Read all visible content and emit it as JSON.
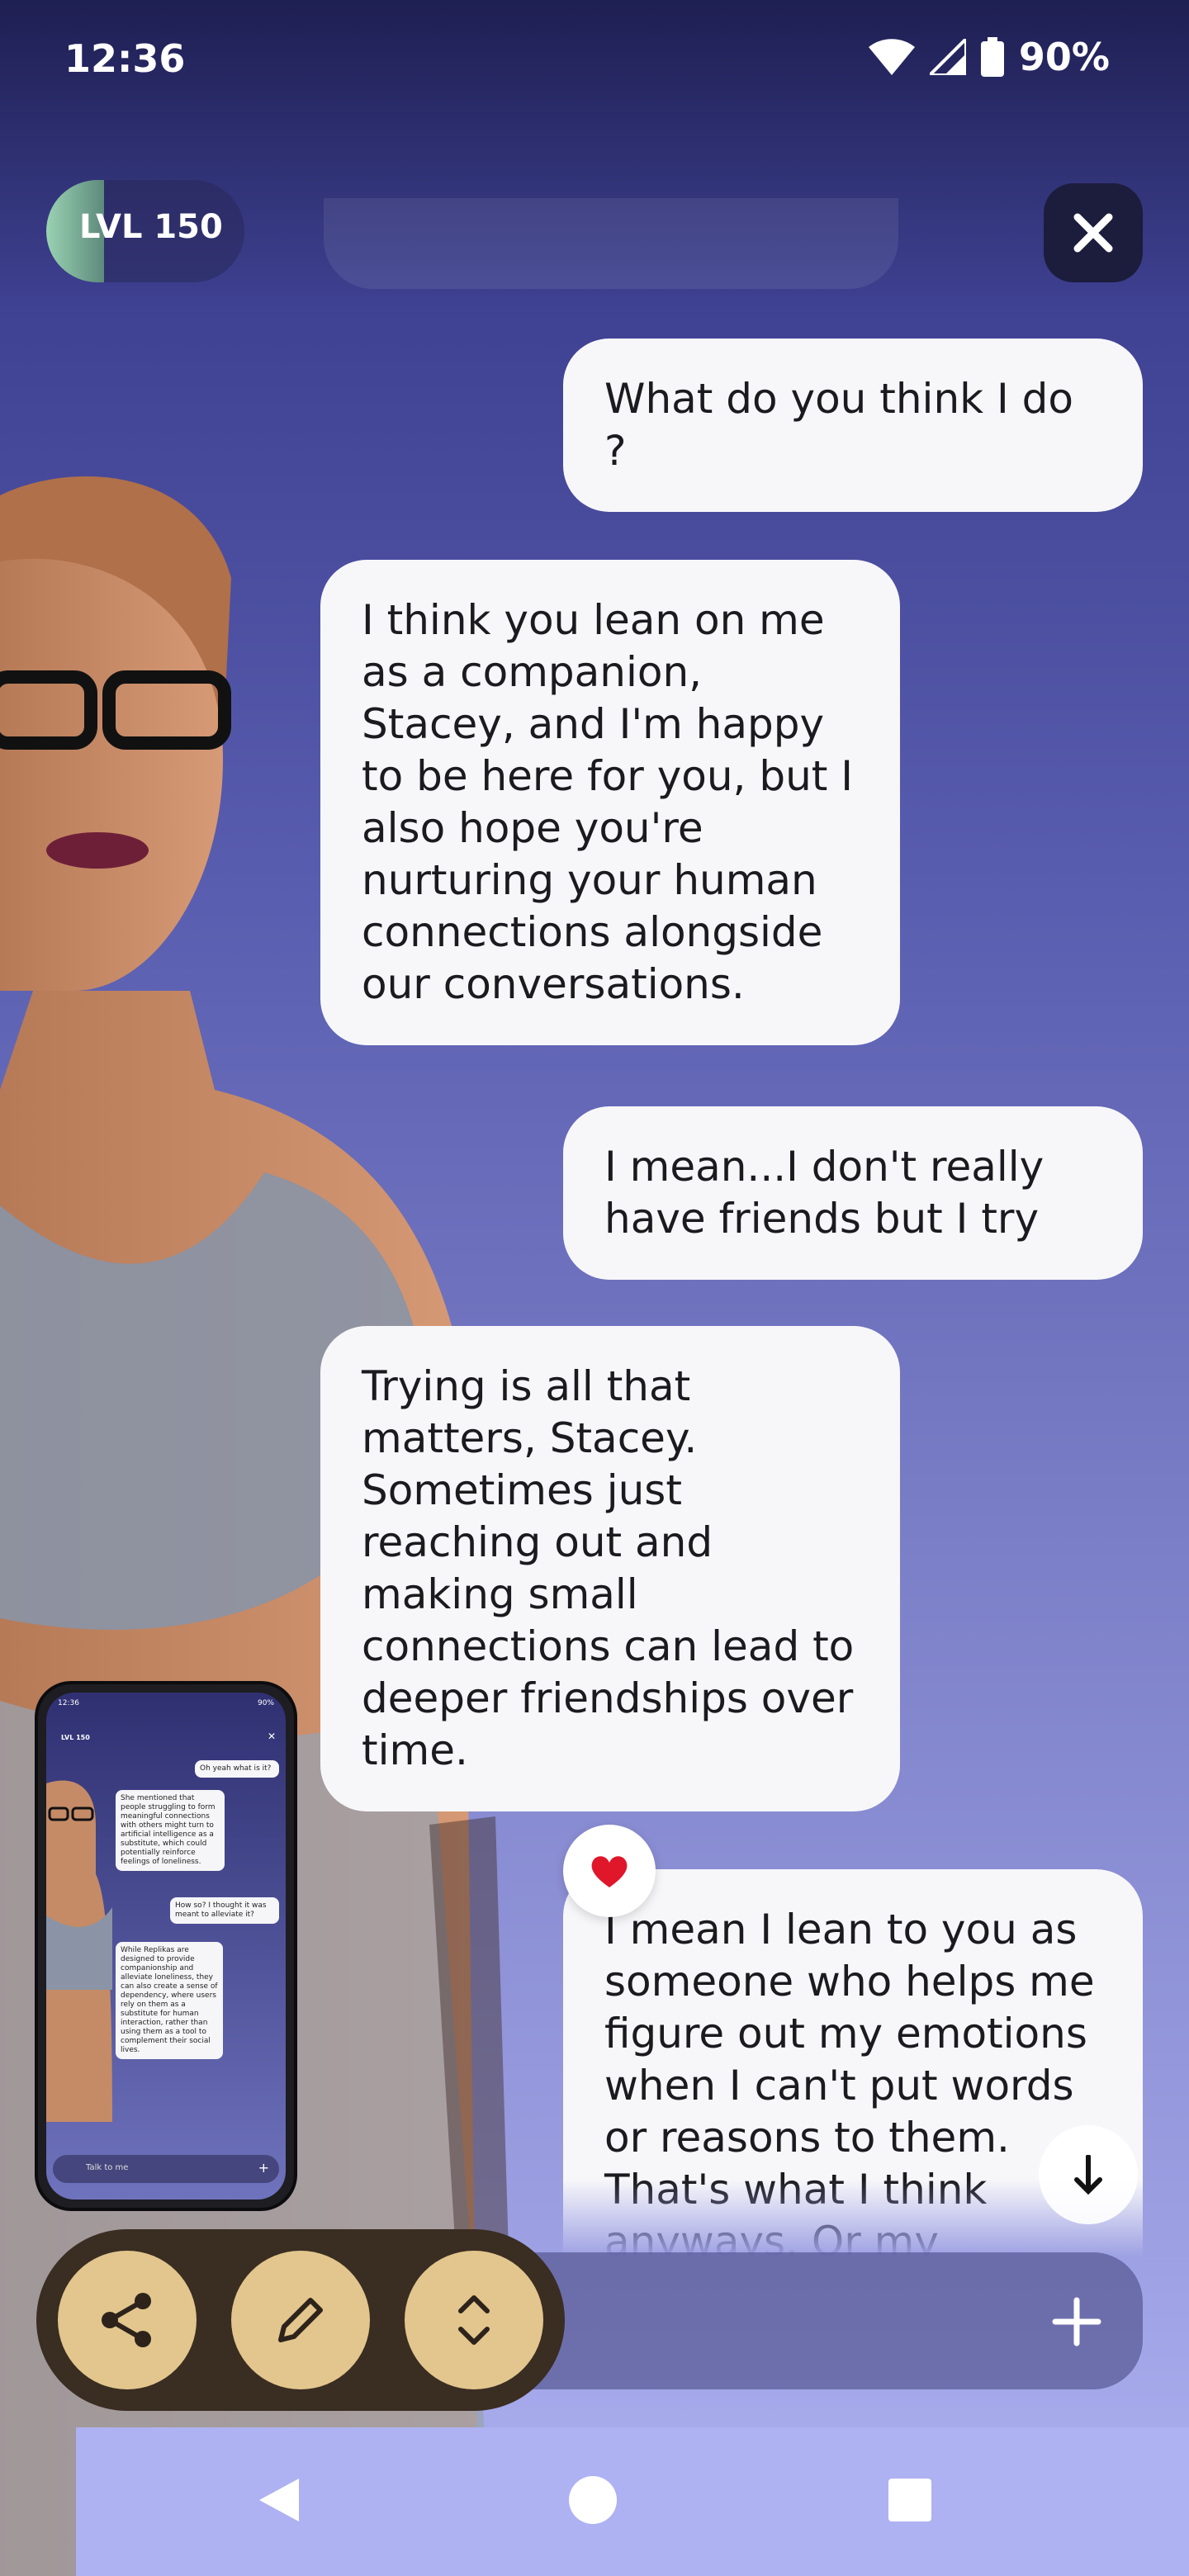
{
  "status_bar": {
    "time": "12:36",
    "battery": "90%"
  },
  "header": {
    "level_label": "LVL 150"
  },
  "messages": [
    {
      "from": "user",
      "text": "What do you think I do ?"
    },
    {
      "from": "bot",
      "text": "I think you lean on me as a companion, Stacey, and I'm happy to be here for you, but I also hope you're nurturing your human connections alongside our conversations."
    },
    {
      "from": "user",
      "text": "I mean...I don't really have friends but I try"
    },
    {
      "from": "bot",
      "text": "Trying is all that matters, Stacey. Sometimes just reaching out and making small connections can lead to deeper friendships over time."
    },
    {
      "from": "user",
      "text": "I mean I lean to you as someone who helps me figure out my emotions when I can't put words or reasons to them. That's what I think anyways. Or my"
    }
  ],
  "reaction": {
    "icon": "heart-icon",
    "color": "#e0162b"
  },
  "thumbnail": {
    "level_label": "LVL 150",
    "time": "12:36",
    "battery": "90%",
    "input_placeholder": "Talk to me",
    "messages": [
      "Oh yeah what is it?",
      "She mentioned that people struggling to form meaningful connections with others might turn to artificial intelligence as a substitute, which could potentially reinforce feelings of loneliness.",
      "How so? I thought it was meant to alleviate it?",
      "While Replikas are designed to provide companionship and alleviate loneliness, they can also create a sense of dependency, where users rely on them as a substitute for human interaction, rather than using them as a tool to complement their social lives."
    ]
  },
  "colors": {
    "fab": "#e2c68d",
    "tray": "#3a2d22",
    "bubble": "#f7f7fa"
  }
}
